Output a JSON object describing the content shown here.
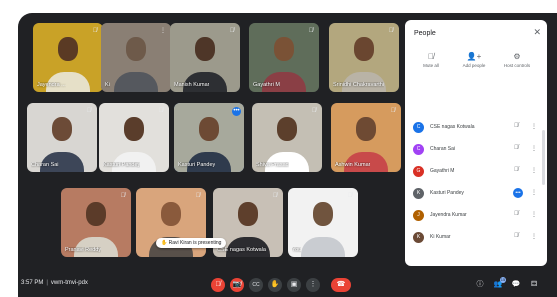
{
  "tiles": [
    {
      "name": "Jayendra ...",
      "bg": "#c9a227",
      "skin": "#5a3a24",
      "shirt": "#e6e0c8",
      "mic": "🎙̸"
    },
    {
      "name": "Ki",
      "bg": "#8a7f74",
      "skin": "#6e5a4a",
      "shirt": "#55585e",
      "mic": "⋮"
    },
    {
      "name": "Manish Kumar",
      "bg": "#9c9a8c",
      "skin": "#4e3628",
      "shirt": "#2d2f33",
      "mic": "🎙̸"
    },
    {
      "name": "Gayathri M",
      "bg": "#5f6d5a",
      "skin": "#7a5236",
      "shirt": "#8a3f45",
      "mic": "🎙̸"
    },
    {
      "name": "Srinidhi Chakravarthi",
      "bg": "#b3a77e",
      "skin": "#6a4630",
      "shirt": "#b9b3a6",
      "mic": "🎙̸"
    },
    {
      "name": "Charan Sai",
      "bg": "#d8d6d2",
      "skin": "#6c4b37",
      "shirt": "#3d4658",
      "mic": "🎙̸"
    },
    {
      "name": "Kasturi Pandey",
      "bg": "#e2e0dc",
      "skin": "#5a3d2b",
      "shirt": "#f1f1f1",
      "mic": "🎙̸"
    },
    {
      "name": "Kasturi Pandey",
      "bg": "#a7a99c",
      "skin": "#6d4a34",
      "shirt": "#2f3b4d",
      "mic": "•••",
      "active": true
    },
    {
      "name": "Shiva Prasad",
      "bg": "#c4bfb4",
      "skin": "#5c3f2c",
      "shirt": "#ffffff",
      "mic": "🎙̸"
    },
    {
      "name": "Ashwin Kumar",
      "bg": "#d69b5e",
      "skin": "#6e4a33",
      "shirt": "#c84a4a",
      "mic": "🎙̸"
    },
    {
      "name": "Pranavi Reddy",
      "bg": "#b77b62",
      "skin": "#5b3b29",
      "shirt": "#d6d0c4",
      "mic": "🎙̸"
    },
    {
      "name": "",
      "bg": "#d9a57c",
      "skin": "#8a5a3c",
      "shirt": "#58504a",
      "mic": "🎙̸"
    },
    {
      "name": "CSE nagas Kotwala",
      "bg": "#c8c0b6",
      "skin": "#5e3f2c",
      "shirt": "#2c2c30",
      "mic": "🎙̸"
    },
    {
      "name": "You",
      "bg": "#f2f2f2",
      "skin": "#70543e",
      "shirt": "#c9ccd1",
      "mic": "🎙̸"
    }
  ],
  "tooltip": "Ravi Kiran is presenting",
  "bottom": {
    "time": "3:57 PM",
    "code": "vwm-tmvi-pdx"
  },
  "panel": {
    "title": "People",
    "actions": [
      {
        "icon": "🎙̸",
        "label": "Mute all"
      },
      {
        "icon": "👤+",
        "label": "Add people"
      },
      {
        "icon": "⚙",
        "label": "Host controls"
      }
    ],
    "participants": [
      {
        "initial": "C",
        "color": "#1a73e8",
        "name": "CSE nagas Kotwala",
        "mic": "🎙̸",
        "speaking": false
      },
      {
        "initial": "C",
        "color": "#a142f4",
        "name": "Charan Sai",
        "mic": "🎙̸",
        "speaking": false
      },
      {
        "initial": "G",
        "color": "#d93025",
        "name": "Gayathri M",
        "mic": "🎙̸",
        "speaking": false
      },
      {
        "initial": "K",
        "color": "#5f6368",
        "name": "Kasturi Pandey",
        "mic": "•••",
        "speaking": true
      },
      {
        "initial": "J",
        "color": "#b06000",
        "name": "Jayendra Kumar",
        "mic": "🎙̸",
        "speaking": false
      },
      {
        "initial": "K",
        "color": "#6b4a36",
        "name": "Ki Kumar",
        "mic": "🎙̸",
        "speaking": false
      }
    ]
  },
  "controls": {
    "mic": "🎙̸",
    "cam": "📷̸",
    "caption": "CC",
    "raise": "✋",
    "present": "▣",
    "more": "⋮",
    "leave": "☎",
    "info": "ⓘ",
    "people": "👥",
    "people_count": "15",
    "chat": "💬",
    "activity": "⚃"
  }
}
